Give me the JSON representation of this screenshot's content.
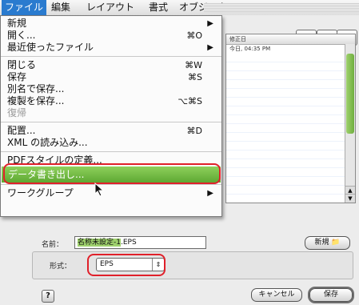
{
  "menubar": {
    "items": [
      "ファイル",
      "編集",
      "レイアウト",
      "書式",
      "オブジェク"
    ]
  },
  "file_menu": {
    "items": [
      {
        "label": "新規",
        "shortcut": "",
        "submenu": true,
        "enabled": true
      },
      {
        "label": "開く...",
        "shortcut": "⌘O",
        "submenu": false,
        "enabled": true
      },
      {
        "label": "最近使ったファイル",
        "shortcut": "",
        "submenu": true,
        "enabled": true
      },
      {
        "label": "閉じる",
        "shortcut": "⌘W",
        "submenu": false,
        "enabled": true
      },
      {
        "label": "保存",
        "shortcut": "⌘S",
        "submenu": false,
        "enabled": true
      },
      {
        "label": "別名で保存...",
        "shortcut": "",
        "submenu": false,
        "enabled": true
      },
      {
        "label": "複製を保存...",
        "shortcut": "⌥⌘S",
        "submenu": false,
        "enabled": true
      },
      {
        "label": "復帰",
        "shortcut": "",
        "submenu": false,
        "enabled": false
      },
      {
        "label": "配置...",
        "shortcut": "⌘D",
        "submenu": false,
        "enabled": true
      },
      {
        "label": "XML の読み込み...",
        "shortcut": "",
        "submenu": false,
        "enabled": true
      },
      {
        "label": "PDFスタイルの定義...",
        "shortcut": "",
        "submenu": false,
        "enabled": true
      },
      {
        "label": "データ書き出し...",
        "shortcut": "",
        "submenu": false,
        "enabled": true,
        "highlighted": true
      },
      {
        "label": "ワークグループ",
        "shortcut": "",
        "submenu": true,
        "enabled": true
      }
    ]
  },
  "file_browser": {
    "column_header": "修正日",
    "rows": [
      "今日, 04:35 PM"
    ]
  },
  "save_dialog": {
    "name_label": "名前：",
    "name_value_selected": "名称未設定-1",
    "name_value_ext": ".EPS",
    "new_folder_label": "新規",
    "format_label": "形式：",
    "format_value": "EPS",
    "help_label": "?",
    "cancel_label": "キャンセル",
    "save_label": "保存"
  },
  "colors": {
    "menu_highlight": "#6fb83f",
    "annotation_ring": "#e0202a",
    "active_menu": "#2a7bcf"
  }
}
